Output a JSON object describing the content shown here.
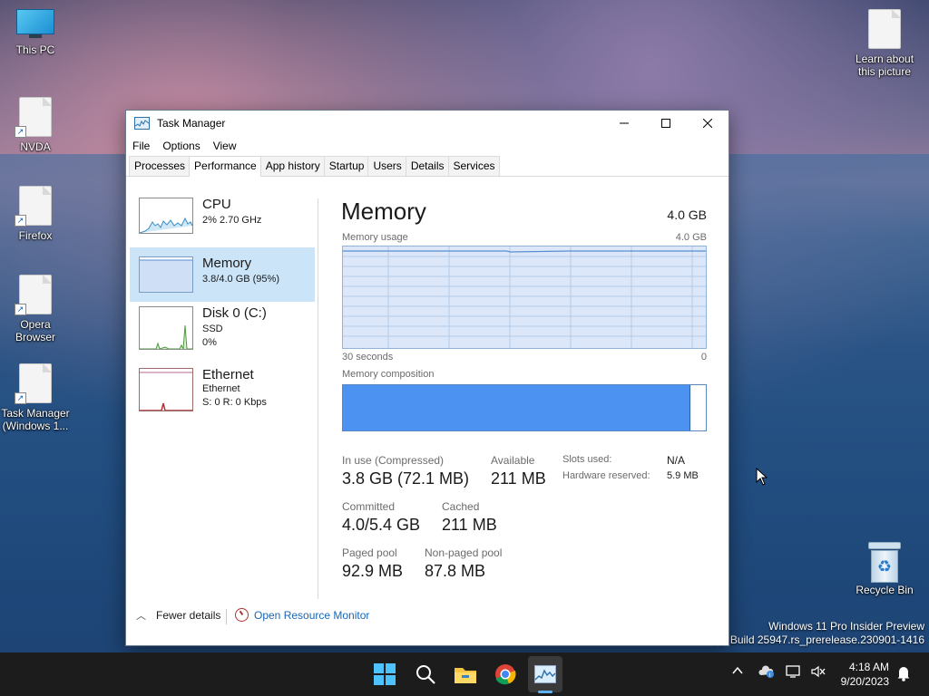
{
  "desktop": {
    "icons": [
      {
        "label": "This PC"
      },
      {
        "label": "NVDA"
      },
      {
        "label": "Firefox"
      },
      {
        "label": "Opera Browser"
      },
      {
        "label": "Task Manager (Windows 1..."
      },
      {
        "label": "Learn about this picture"
      },
      {
        "label": "Recycle Bin"
      }
    ],
    "watermark": {
      "line1": "Windows 11 Pro Insider Preview",
      "line2": "py. Build 25947.rs_prerelease.230901-1416"
    }
  },
  "window": {
    "title": "Task Manager",
    "menu": [
      "File",
      "Options",
      "View"
    ],
    "tabs": [
      "Processes",
      "Performance",
      "App history",
      "Startup",
      "Users",
      "Details",
      "Services"
    ],
    "active_tab": "Performance",
    "sidebar": [
      {
        "name": "CPU",
        "line1": "2%  2.70 GHz"
      },
      {
        "name": "Memory",
        "line1": "3.8/4.0 GB (95%)"
      },
      {
        "name": "Disk 0 (C:)",
        "line1": "SSD",
        "line2": "0%"
      },
      {
        "name": "Ethernet",
        "line1": "Ethernet",
        "line2": "S: 0  R: 0 Kbps"
      }
    ],
    "panel": {
      "title": "Memory",
      "total": "4.0 GB",
      "usage_label": "Memory usage",
      "usage_max": "4.0 GB",
      "time_left": "30 seconds",
      "time_right": "0",
      "composition_label": "Memory composition",
      "composition_in_use_fraction": 0.955,
      "stats": {
        "in_use_label": "In use (Compressed)",
        "in_use_value": "3.8 GB (72.1 MB)",
        "available_label": "Available",
        "available_value": "211 MB",
        "committed_label": "Committed",
        "committed_value": "4.0/5.4 GB",
        "cached_label": "Cached",
        "cached_value": "211 MB",
        "paged_label": "Paged pool",
        "paged_value": "92.9 MB",
        "nonpaged_label": "Non-paged pool",
        "nonpaged_value": "87.8 MB",
        "slots_label": "Slots used:",
        "slots_value": "N/A",
        "hwres_label": "Hardware reserved:",
        "hwres_value": "5.9 MB"
      }
    },
    "footer": {
      "fewer": "Fewer details",
      "resmon": "Open Resource Monitor"
    }
  },
  "taskbar": {
    "time": "4:18 AM",
    "date": "9/20/2023",
    "accent": "#5fb2f2"
  }
}
